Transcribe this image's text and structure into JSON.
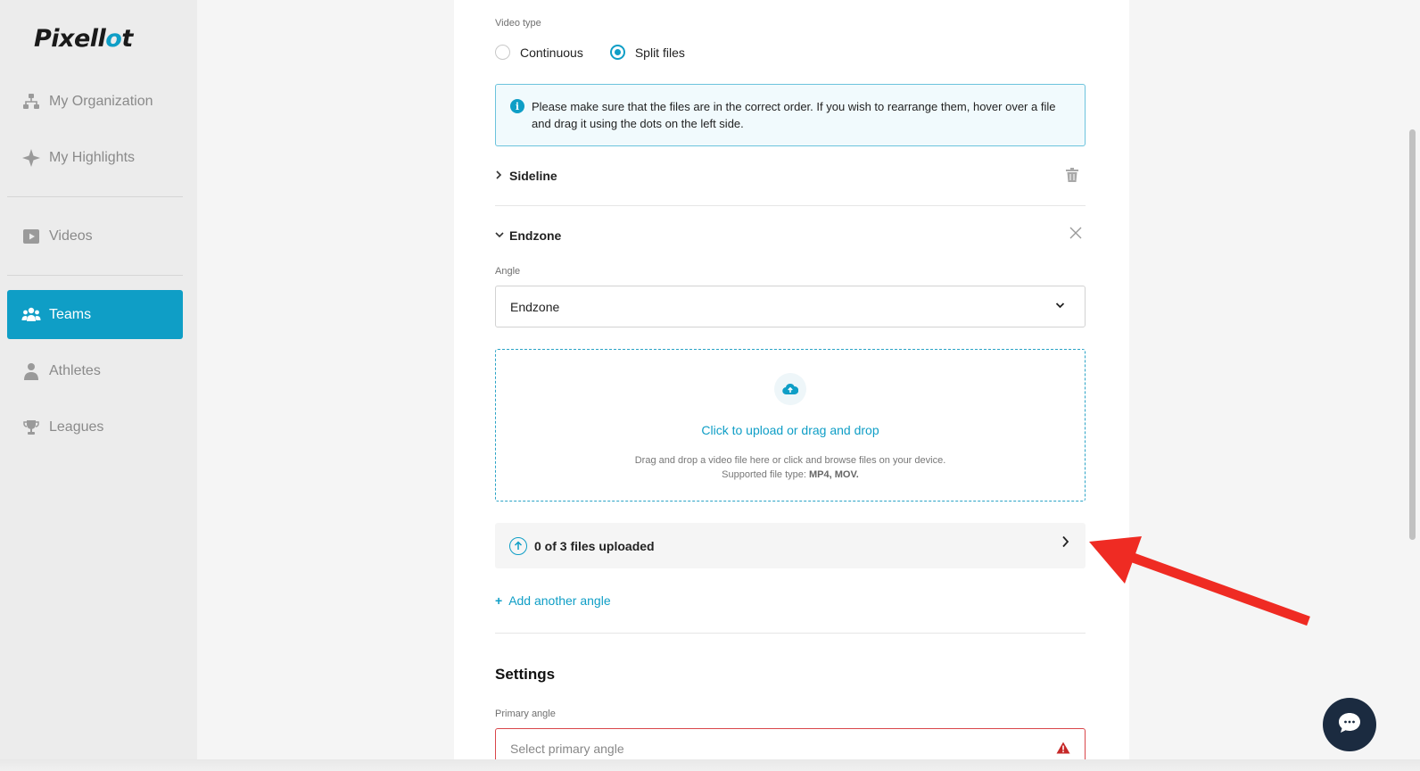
{
  "brand": {
    "logo_prefix": "Pixell",
    "logo_o": "o",
    "logo_suffix": "t",
    "accent_color": "#0f9ec6",
    "error_color": "#d9464a",
    "annotation_color": "#ef2b23"
  },
  "sidebar": {
    "items": [
      {
        "label": "My Organization",
        "icon": "org-chart-icon",
        "active": false
      },
      {
        "label": "My Highlights",
        "icon": "sparkle-icon",
        "active": false
      },
      {
        "label": "Videos",
        "icon": "video-play-icon",
        "active": false
      },
      {
        "label": "Teams",
        "icon": "team-icon",
        "active": true
      },
      {
        "label": "Athletes",
        "icon": "athlete-icon",
        "active": false
      },
      {
        "label": "Leagues",
        "icon": "trophy-icon",
        "active": false
      }
    ]
  },
  "form": {
    "video_type_label": "Video type",
    "video_type_options": [
      {
        "label": "Continuous",
        "checked": false
      },
      {
        "label": "Split files",
        "checked": true
      }
    ],
    "info_message": "Please make sure that the files are in the correct order. If you wish to rearrange them, hover over a file and drag it using the dots on the left side.",
    "angles": [
      {
        "title": "Sideline",
        "expanded": false
      },
      {
        "title": "Endzone",
        "expanded": true
      }
    ],
    "angle_label": "Angle",
    "angle_value": "Endzone",
    "dropzone": {
      "title": "Click to upload or drag and drop",
      "desc_line1": "Drag and drop a video file here or click and browse files on your device.",
      "desc_prefix": "Supported file type: ",
      "desc_types": "MP4, MOV."
    },
    "upload_status": "0 of 3 files uploaded",
    "add_angle": "Add another angle",
    "settings_title": "Settings",
    "primary_angle_label": "Primary angle",
    "primary_angle_placeholder": "Select primary angle"
  }
}
